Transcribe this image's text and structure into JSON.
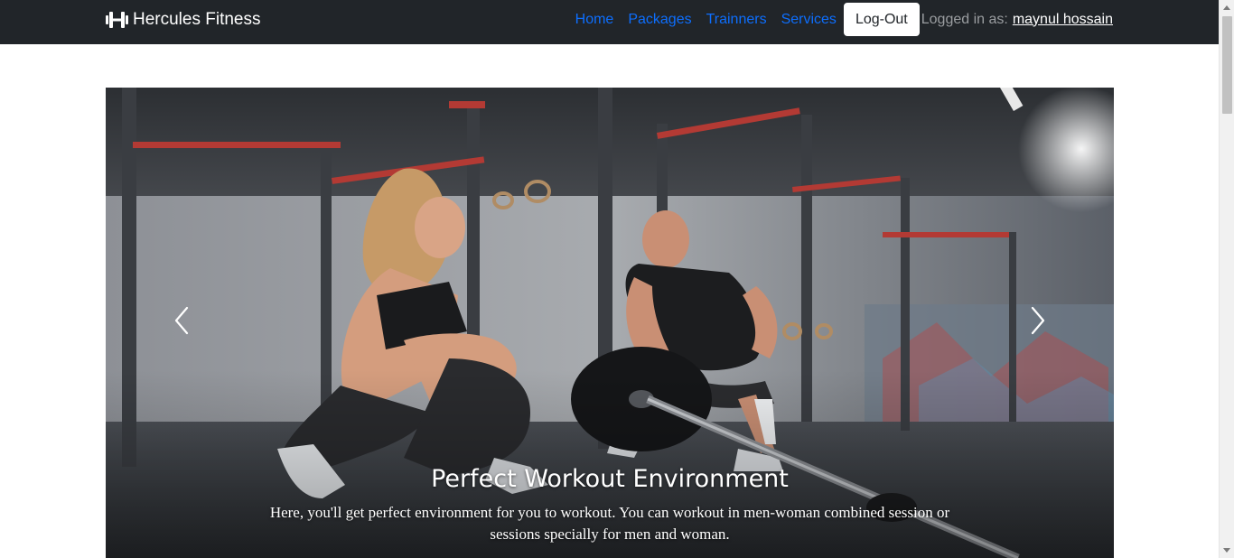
{
  "brand": {
    "name": "Hercules Fitness",
    "icon": "dumbbell-icon"
  },
  "nav": {
    "links": [
      "Home",
      "Packages",
      "Trainners",
      "Services"
    ],
    "logout_label": "Log-Out",
    "login_prefix": "Logged in as:",
    "user_name": "maynul hossain"
  },
  "carousel": {
    "slide_title": "Perfect Workout Environment",
    "slide_text": "Here, you'll get perfect environment for you to workout. You can workout in men-woman combined session or sessions specially for men and woman.",
    "prev_icon": "chevron-left-icon",
    "next_icon": "chevron-right-icon"
  },
  "colors": {
    "navbar_bg": "#212529",
    "nav_link": "#0d6efd",
    "login_label": "#9a9da0"
  }
}
